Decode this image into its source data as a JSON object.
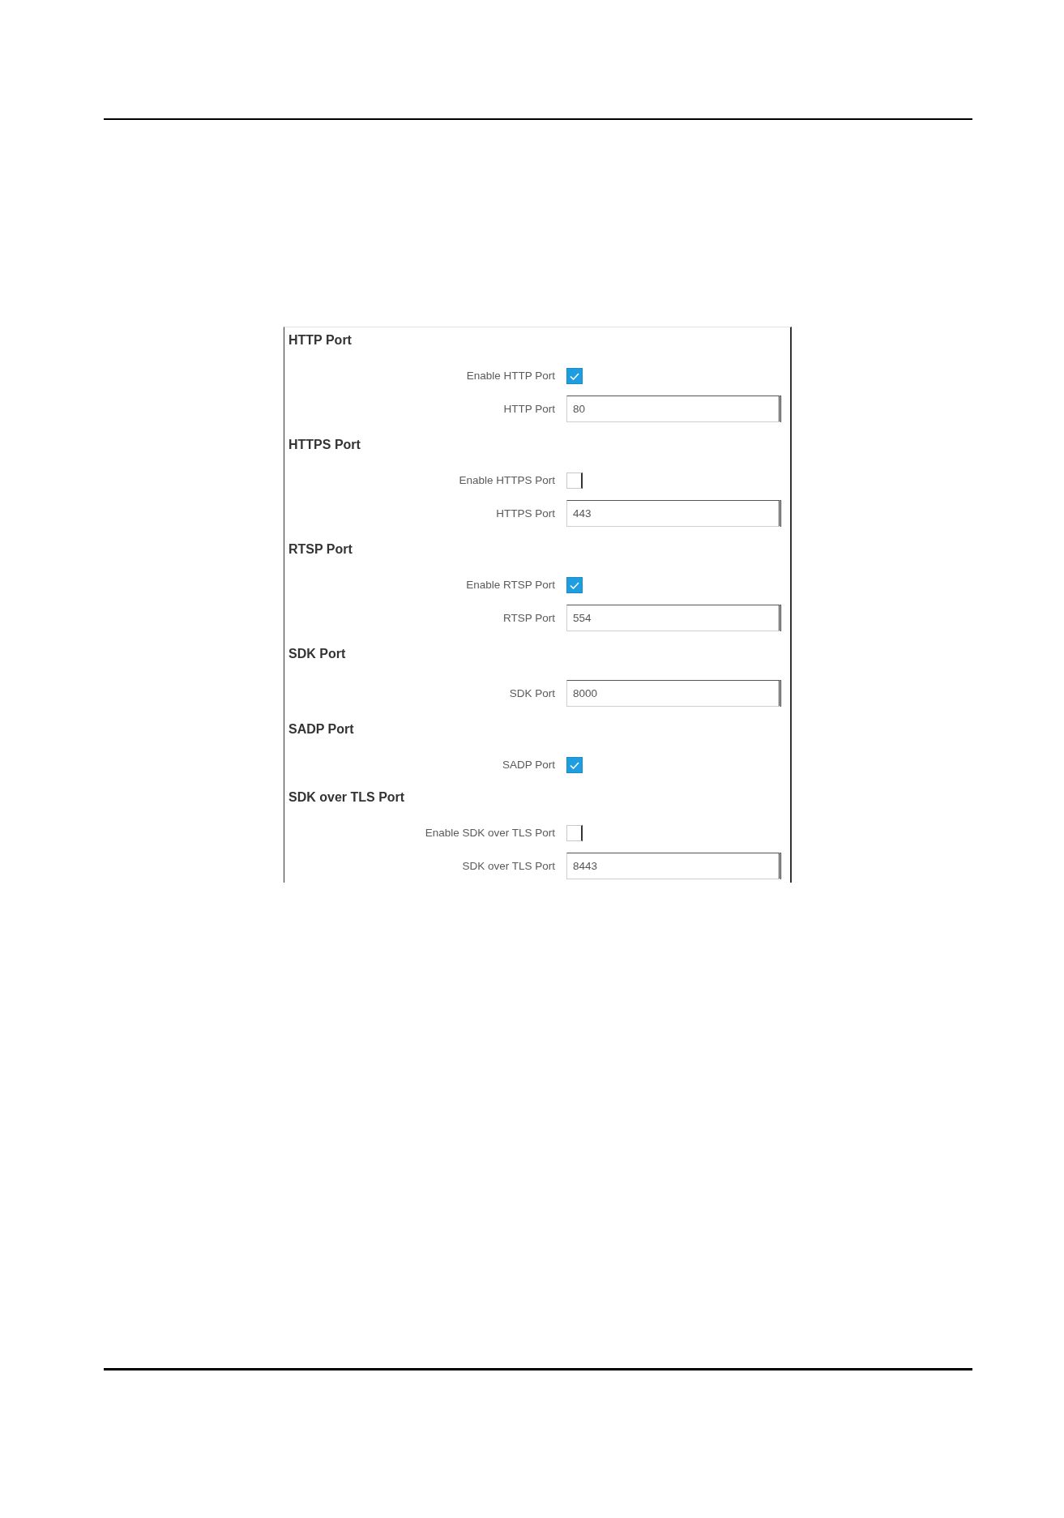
{
  "sections": [
    {
      "title": "HTTP Port",
      "fields": [
        {
          "kind": "checkbox",
          "label": "Enable HTTP Port",
          "checked": true
        },
        {
          "kind": "text",
          "label": "HTTP Port",
          "value": "80"
        }
      ]
    },
    {
      "title": "HTTPS Port",
      "fields": [
        {
          "kind": "checkbox",
          "label": "Enable HTTPS Port",
          "checked": false
        },
        {
          "kind": "text",
          "label": "HTTPS Port",
          "value": "443"
        }
      ]
    },
    {
      "title": "RTSP Port",
      "fields": [
        {
          "kind": "checkbox",
          "label": "Enable RTSP Port",
          "checked": true
        },
        {
          "kind": "text",
          "label": "RTSP Port",
          "value": "554"
        }
      ]
    },
    {
      "title": "SDK Port",
      "fields": [
        {
          "kind": "text",
          "label": "SDK Port",
          "value": "8000"
        }
      ]
    },
    {
      "title": "SADP Port",
      "fields": [
        {
          "kind": "checkbox",
          "label": "SADP Port",
          "checked": true
        }
      ]
    },
    {
      "title": "SDK over TLS Port",
      "fields": [
        {
          "kind": "checkbox",
          "label": "Enable SDK over TLS Port",
          "checked": false
        },
        {
          "kind": "text",
          "label": "SDK over TLS Port",
          "value": "8443"
        }
      ]
    }
  ]
}
